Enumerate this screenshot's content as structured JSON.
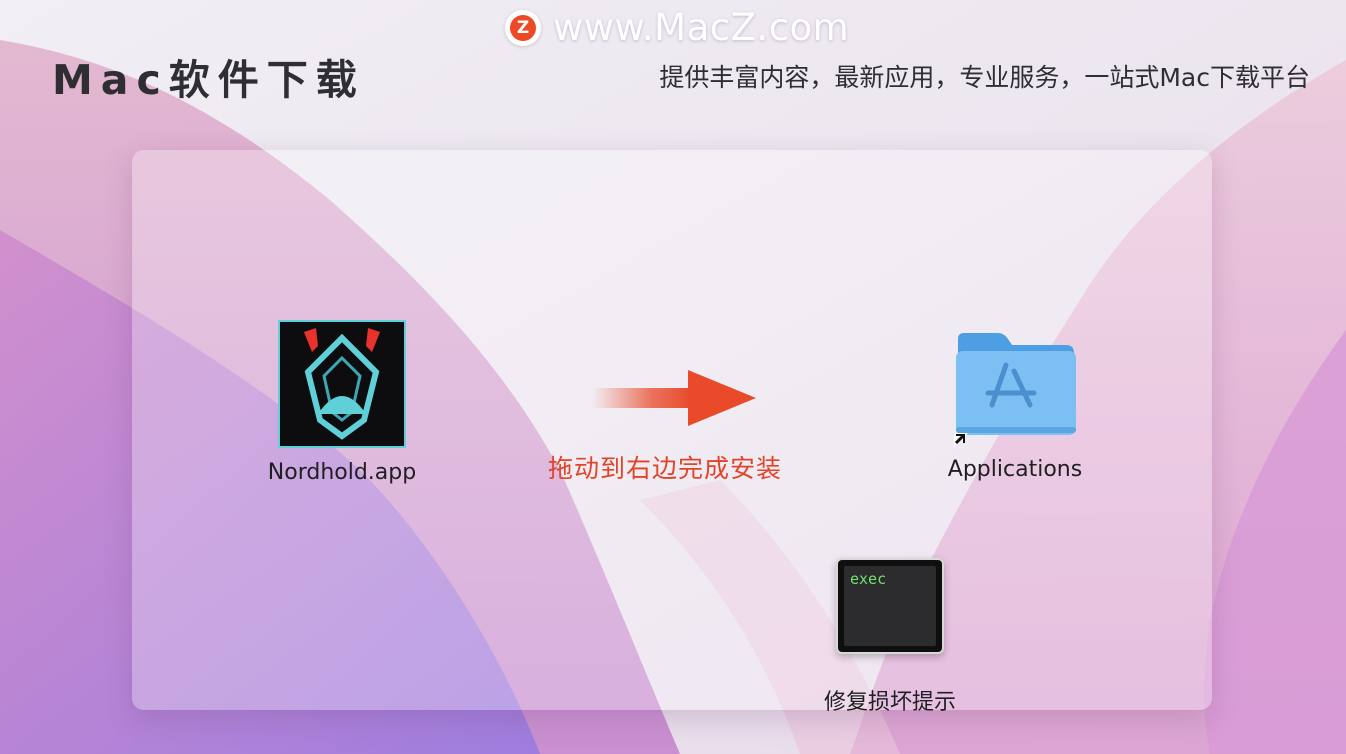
{
  "header": {
    "logo_letter": "Z",
    "site_url": "www.MacZ.com",
    "brand_title": "Mac软件下载",
    "tagline": "提供丰富内容，最新应用，专业服务，一站式Mac下载平台"
  },
  "installer": {
    "app": {
      "label": "Nordhold.app",
      "icon": "nordhold-app-icon"
    },
    "hint": "拖动到右边完成安装",
    "arrow_color": "#e84a2a",
    "applications": {
      "label": "Applications",
      "icon": "applications-folder-icon"
    },
    "repair": {
      "label": "修复损坏提示",
      "icon_text": "exec",
      "icon": "terminal-exec-icon"
    }
  },
  "colors": {
    "accent": "#ec4a25",
    "hint_text": "#e0452a",
    "folder_blue": "#6fb8f0"
  }
}
